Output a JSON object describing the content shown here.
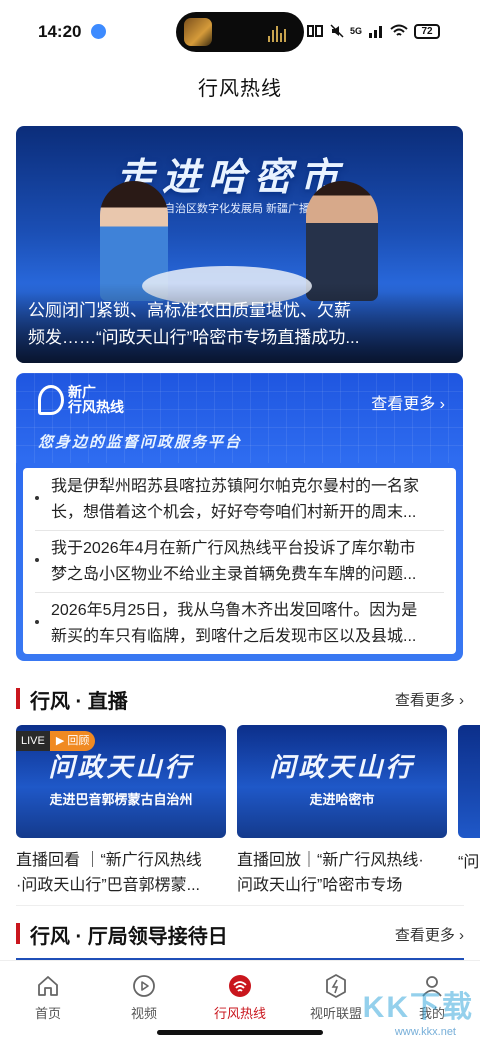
{
  "status_bar": {
    "time": "14:20",
    "network_label": "5G",
    "battery": "72"
  },
  "page": {
    "title": "行风热线"
  },
  "banner": {
    "art_headline": "走进哈密市",
    "art_subtitle": "自治区数字化发展局 新疆广播电",
    "caption_line1": "公厕闭门紧锁、高标准农田质量堪忧、欠薪",
    "caption_line2": "频发……“问政天山行”哈密市专场直播成功..."
  },
  "hotline": {
    "logo_line1": "新广",
    "logo_line2": "行风热线",
    "more_label": "查看更多 ›",
    "slogan": "您身边的监督问政服务平台",
    "items": [
      {
        "line1": "我是伊犁州昭苏县喀拉苏镇阿尔帕克尔曼村的一名家",
        "line2": "长，想借着这个机会，好好夸夸咱们村新开的周末..."
      },
      {
        "line1": "我于2026年4月在新广行风热线平台投诉了库尔勒市",
        "line2": "梦之岛小区物业不给业主录首辆免费车车牌的问题..."
      },
      {
        "line1": "2026年5月25日，我从乌鲁木齐出发回喀什。因为是",
        "line2": "新买的车只有临牌，到喀什之后发现市区以及县城..."
      }
    ]
  },
  "live_section": {
    "title": "行风 · 直播",
    "more_label": "查看更多 ›",
    "cards": [
      {
        "badge_live": "LIVE",
        "badge_replay": "▶ 回顾",
        "art_title": "问政天山行",
        "art_sub": "走进巴音郭楞蒙古自治州",
        "title_line1": "直播回看 ｜“新广行风热线",
        "title_line2": "·问政天山行”巴音郭楞蒙..."
      },
      {
        "art_title": "问政天山行",
        "art_sub": "走进哈密市",
        "title_line1": "直播回放｜“新广行风热线·",
        "title_line2": "问政天山行”哈密市专场"
      }
    ],
    "peek_text": "“问 克自"
  },
  "reception_section": {
    "title": "行风 · 厅局领导接待日",
    "more_label": "查看更多 ›"
  },
  "tabs": [
    {
      "label": "首页",
      "icon": "home-icon"
    },
    {
      "label": "视频",
      "icon": "play-icon"
    },
    {
      "label": "行风热线",
      "icon": "hotline-icon"
    },
    {
      "label": "视听联盟",
      "icon": "bolt-icon"
    },
    {
      "label": "我的",
      "icon": "user-icon"
    }
  ],
  "watermark": {
    "text": "KK下载",
    "url": "www.kkx.net"
  },
  "colors": {
    "accent": "#c9161d",
    "brand_blue": "#2e6cf0"
  }
}
